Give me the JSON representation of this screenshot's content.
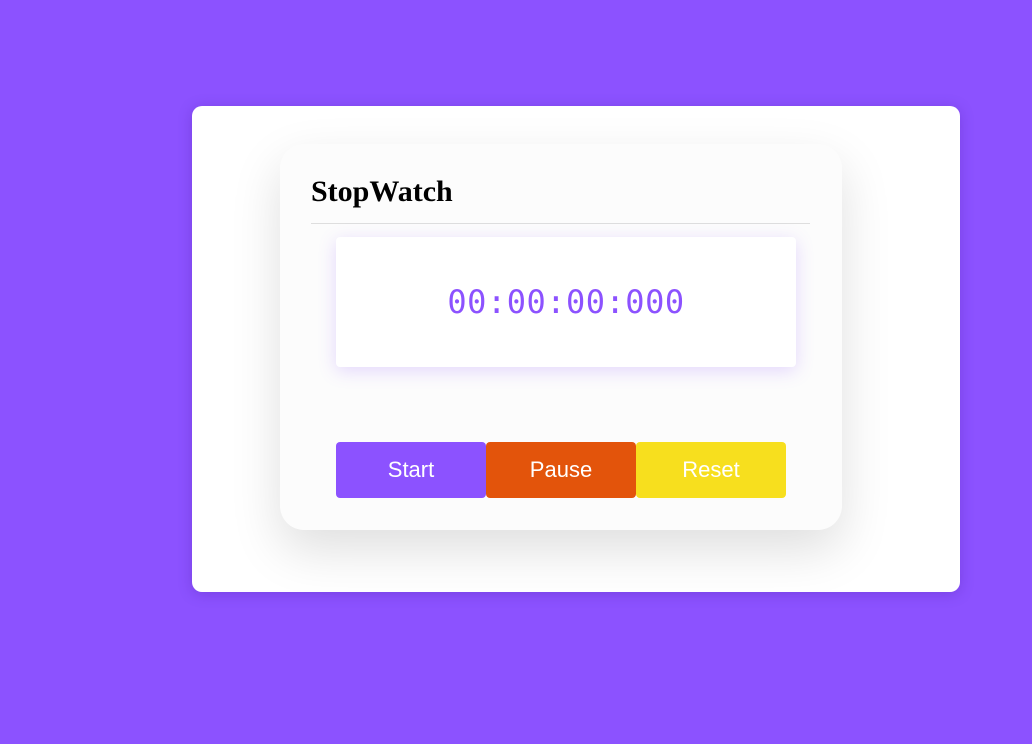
{
  "stopwatch": {
    "title": "StopWatch",
    "time": "00:00:00:000",
    "buttons": {
      "start": "Start",
      "pause": "Pause",
      "reset": "Reset"
    }
  },
  "colors": {
    "background": "#8c52ff",
    "accent": "#8c52ff",
    "start": "#8c52ff",
    "pause": "#e3540b",
    "reset": "#f7df1e"
  }
}
